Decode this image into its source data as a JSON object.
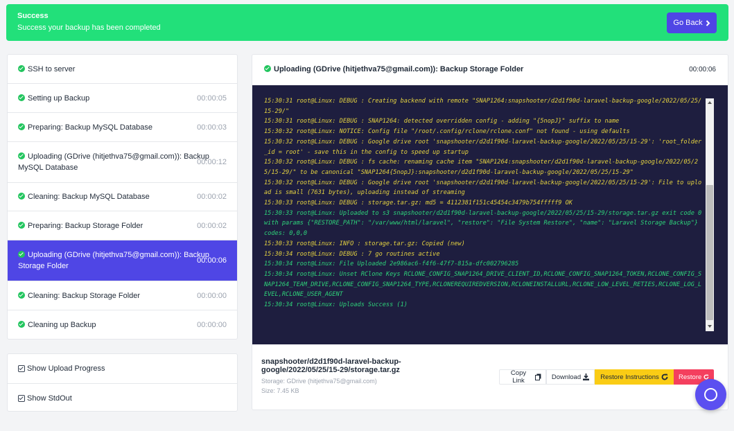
{
  "banner": {
    "title": "Success",
    "message": "Success your backup has been completed",
    "go_back_label": "Go Back",
    "go_back_icon": "chevron-right-icon"
  },
  "steps": [
    {
      "label": "SSH to server",
      "time": ""
    },
    {
      "label": "Setting up Backup",
      "time": "00:00:05"
    },
    {
      "label": "Preparing: Backup MySQL Database",
      "time": "00:00:03"
    },
    {
      "label": "Uploading (GDrive (hitjethva75@gmail.com)): Backup MySQL Database",
      "time": "00:00:12"
    },
    {
      "label": "Cleaning: Backup MySQL Database",
      "time": "00:00:02"
    },
    {
      "label": "Preparing: Backup Storage Folder",
      "time": "00:00:02"
    },
    {
      "label": "Uploading (GDrive (hitjethva75@gmail.com)): Backup Storage Folder",
      "time": "00:00:06"
    },
    {
      "label": "Cleaning: Backup Storage Folder",
      "time": "00:00:00"
    },
    {
      "label": "Cleaning up Backup",
      "time": "00:00:00"
    }
  ],
  "options": [
    {
      "label": "Show Upload Progress",
      "checked": true
    },
    {
      "label": "Show StdOut",
      "checked": true
    }
  ],
  "panel": {
    "title": "Uploading (GDrive (hitjethva75@gmail.com)): Backup Storage Folder",
    "time": "00:00:06"
  },
  "log": [
    {
      "text": "15:30:31 root@Linux: DEBUG : Creating backend with remote \"SNAP1264:snapshooter/d2d1f90d-laravel-backup-google/2022/05/25/15-29/\"",
      "color": "yellow"
    },
    {
      "text": "15:30:31 root@Linux: DEBUG : SNAP1264: detected overridden config - adding \"{5nopJ}\" suffix to name",
      "color": "yellow"
    },
    {
      "text": "15:30:32 root@Linux: NOTICE: Config file \"/root/.config/rclone/rclone.conf\" not found - using defaults",
      "color": "yellow"
    },
    {
      "text": "15:30:32 root@Linux: DEBUG : Google drive root 'snapshooter/d2d1f90d-laravel-backup-google/2022/05/25/15-29': 'root_folder_id = root' - save this in the config to speed up startup",
      "color": "yellow"
    },
    {
      "text": "15:30:32 root@Linux: DEBUG : fs cache: renaming cache item \"SNAP1264:snapshooter/d2d1f90d-laravel-backup-google/2022/05/25/15-29/\" to be canonical \"SNAP1264{5nopJ}:snapshooter/d2d1f90d-laravel-backup-google/2022/05/25/15-29\"",
      "color": "yellow"
    },
    {
      "text": "15:30:32 root@Linux: DEBUG : Google drive root 'snapshooter/d2d1f90d-laravel-backup-google/2022/05/25/15-29': File to upload is small (7631 bytes), uploading instead of streaming",
      "color": "yellow"
    },
    {
      "text": "15:30:33 root@Linux: DEBUG : storage.tar.gz: md5 = 4112381f151c45454c3479b754fffff9 OK",
      "color": "yellow"
    },
    {
      "text": "15:30:33 root@Linux: Uploaded to s3 snapshooter/d2d1f90d-laravel-backup-google/2022/05/25/15-29/storage.tar.gz exit code 0 with params {\"RESTORE_PATH\": \"/var/www/html/laravel\", \"restore\": \"File System Restore\", \"name\": \"Laravel Storage Backup\"} codes: 0,0,0",
      "color": "green"
    },
    {
      "text": "15:30:33 root@Linux: INFO : storage.tar.gz: Copied (new)",
      "color": "yellow"
    },
    {
      "text": "15:30:34 root@Linux: DEBUG : 7 go routines active",
      "color": "yellow"
    },
    {
      "text": "15:30:34 root@Linux: File Uploaded 2e986ac6-f4f6-47f7-815a-dfc002796285",
      "color": "green"
    },
    {
      "text": "15:30:34 root@Linux: Unset RClone Keys RCLONE_CONFIG_SNAP1264_DRIVE_CLIENT_ID,RCLONE_CONFIG_SNAP1264_TOKEN,RCLONE_CONFIG_SNAP1264_TEAM_DRIVE,RCLONE_CONFIG_SNAP1264_TYPE,RCLONEREQUIREDVERSION,RCLONEINSTALLURL,RCLONE_LOW_LEVEL_RETIES,RCLONE_LOG_LEVEL,RCLONE_USER_AGENT",
      "color": "green"
    },
    {
      "text": "15:30:34 root@Linux: Uploads Success (1)",
      "color": "green"
    }
  ],
  "file": {
    "name": "snapshooter/d2d1f90d-laravel-backup-google/2022/05/25/15-29/storage.tar.gz",
    "storage": "Storage: GDrive (hitjethva75@gmail.com)",
    "size": "Size: 7.45 KB"
  },
  "actions": {
    "copy_link": "Copy Link",
    "download": "Download",
    "restore_instructions": "Restore Instructions",
    "restore": "Restore"
  },
  "colors": {
    "success_banner": "#22e07a",
    "accent": "#4f46e5",
    "console_bg": "#1e1e3f",
    "log_yellow": "#e5d340",
    "log_green": "#2ed47a",
    "instructions_button": "#facc15",
    "restore_button": "#f43f5e"
  }
}
